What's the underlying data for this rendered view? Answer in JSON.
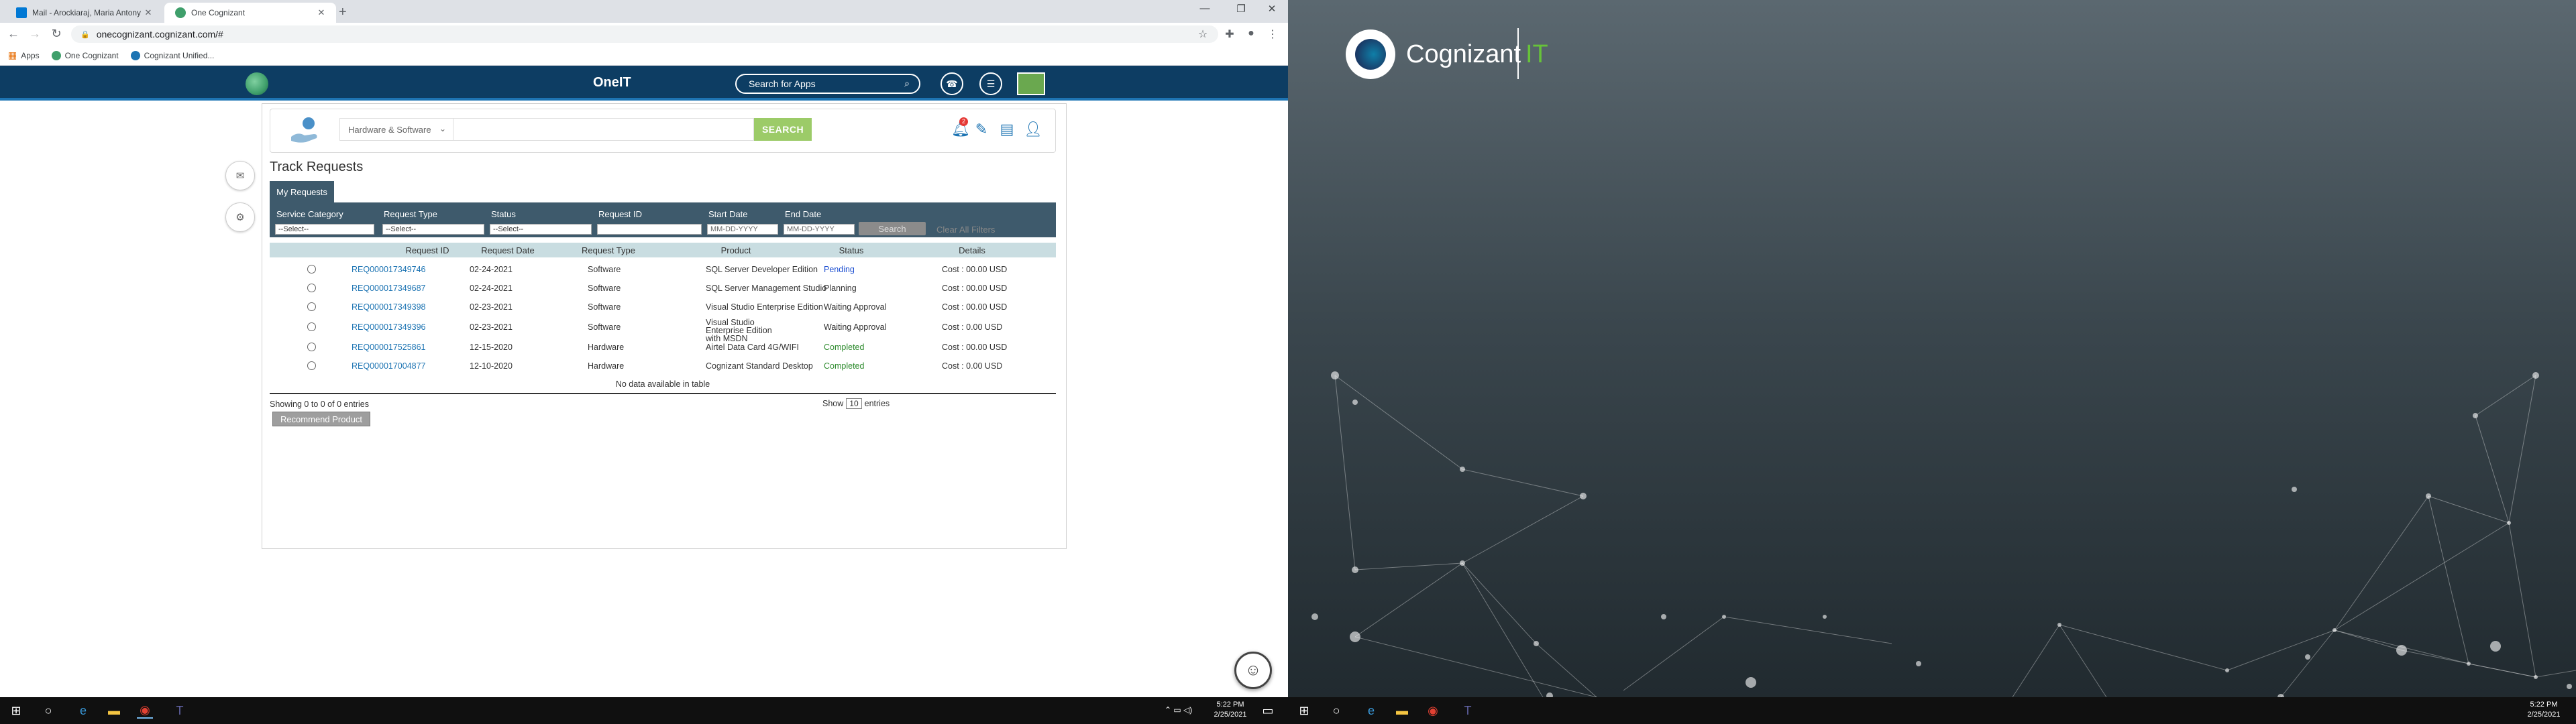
{
  "chrome": {
    "tabs": [
      {
        "label": "Mail - Arockiaraj, Maria Antony (",
        "favicon_color": "#0078d4"
      },
      {
        "label": "One Cognizant",
        "favicon_color": "#3f9f6b"
      }
    ],
    "url": "onecognizant.cognizant.com/#",
    "bookmarks": [
      "Apps",
      "One Cognizant",
      "Cognizant Unified..."
    ]
  },
  "oneit": {
    "title": "OneIT",
    "search_placeholder": "Search for Apps"
  },
  "panel": {
    "category": "Hardware & Software",
    "search_button": "SEARCH",
    "notification_count": "2"
  },
  "page": {
    "title": "Track Requests",
    "tab": "My Requests",
    "filters": {
      "service_category_label": "Service Category",
      "service_category_value": "--Select--",
      "request_type_label": "Request Type",
      "request_type_value": "--Select--",
      "status_label": "Status",
      "status_value": "--Select--",
      "request_id_label": "Request ID",
      "request_id_value": "",
      "start_date_label": "Start Date",
      "start_date_placeholder": "MM-DD-YYYY",
      "end_date_label": "End Date",
      "end_date_placeholder": "MM-DD-YYYY",
      "search_button": "Search",
      "clear_link": "Clear All Filters"
    },
    "columns": [
      "Request ID",
      "Request Date",
      "Request Type",
      "Product",
      "Status",
      "Details"
    ],
    "rows": [
      {
        "id": "REQ000017349746",
        "date": "02-24-2021",
        "type": "Software",
        "product": "SQL Server Developer Edition",
        "status": "Pending",
        "details": "Cost : 00.00 USD"
      },
      {
        "id": "REQ000017349687",
        "date": "02-24-2021",
        "type": "Software",
        "product": "SQL Server Management Studio",
        "status": "Planning",
        "details": "Cost : 00.00 USD"
      },
      {
        "id": "REQ000017349398",
        "date": "02-23-2021",
        "type": "Software",
        "product": "Visual Studio Enterprise Edition",
        "status": "Waiting Approval",
        "details": "Cost : 00.00 USD"
      },
      {
        "id": "REQ000017349396",
        "date": "02-23-2021",
        "type": "Software",
        "product": "Visual Studio Enterprise Edition with MSDN",
        "status": "Waiting Approval",
        "details": "Cost : 0.00 USD"
      },
      {
        "id": "REQ000017525861",
        "date": "12-15-2020",
        "type": "Hardware",
        "product": "Airtel Data Card 4G/WIFI",
        "status": "Completed",
        "details": "Cost : 00.00 USD"
      },
      {
        "id": "REQ000017004877",
        "date": "12-10-2020",
        "type": "Hardware",
        "product": "Cognizant Standard Desktop",
        "status": "Completed",
        "details": "Cost : 0.00 USD"
      }
    ],
    "no_data": "No data available in table",
    "showing": "Showing 0 to 0 of 0 entries",
    "show_label": "Show",
    "show_value": "10",
    "entries_label": "entries",
    "recommend_button": "Recommend Product"
  },
  "taskbar_left": {
    "time": "5:22 PM",
    "date": "2/25/2021"
  },
  "taskbar_right": {
    "time": "5:22 PM",
    "date": "2/25/2021"
  },
  "wallpaper": {
    "brand": "Cognizant",
    "suffix": "IT"
  }
}
